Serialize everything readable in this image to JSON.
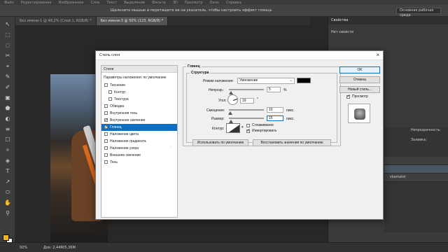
{
  "app": {
    "menu": [
      "Файл",
      "Редактирование",
      "Изображение",
      "Слои",
      "Текст",
      "Выделение",
      "Фильтр",
      "3D",
      "Просмотр",
      "Окно",
      "Справка"
    ],
    "options_hint": "Щелкните мышью и перетащите ее на указатель, чтобы настроить эффект глянца.",
    "workspace": "Основная рабочая среда"
  },
  "tabs": [
    "Без имени-1 @ 48,2% (Слой 1, RGB/8) *",
    "Без имени-3 @ 50% (123, RGB/8) *"
  ],
  "tools": [
    "↖",
    "⬚",
    "◌",
    "✂",
    "⌖",
    "✎",
    "✐",
    "▣",
    "⬟",
    "◐",
    "≡",
    "☐",
    "✧",
    "◈",
    "T",
    "↗",
    "⬭",
    "✋",
    "⚲"
  ],
  "colors": {
    "foreground": "#f2b51d",
    "background": "#ffffff",
    "selection": "#0a6fc2"
  },
  "right_panel": {
    "title": "Свойства",
    "no_properties": "Нет свойств",
    "opacity_label": "Непрозрачность:",
    "fill_label": "Заливка:",
    "layer_name": "vkamahd"
  },
  "status": {
    "zoom": "50%",
    "doc": "Док: 2,44M/5,36M"
  },
  "dialog": {
    "title": "Стиль слоя",
    "styles_header": "Стили",
    "blend_defaults": "Параметры наложения: по умолчанию",
    "styles": [
      {
        "label": "Тиснение",
        "checked": false,
        "indent": false,
        "selected": false
      },
      {
        "label": "Контур",
        "checked": false,
        "indent": true,
        "selected": false
      },
      {
        "label": "Текстура",
        "checked": false,
        "indent": true,
        "selected": false
      },
      {
        "label": "Обводка",
        "checked": false,
        "indent": false,
        "selected": false
      },
      {
        "label": "Внутренняя тень",
        "checked": false,
        "indent": false,
        "selected": false
      },
      {
        "label": "Внутреннее свечение",
        "checked": true,
        "indent": false,
        "selected": false
      },
      {
        "label": "Глянец",
        "checked": true,
        "indent": false,
        "selected": true
      },
      {
        "label": "Наложение цвета",
        "checked": false,
        "indent": false,
        "selected": false
      },
      {
        "label": "Наложение градиента",
        "checked": false,
        "indent": false,
        "selected": false
      },
      {
        "label": "Наложение узора",
        "checked": false,
        "indent": false,
        "selected": false
      },
      {
        "label": "Внешнее свечение",
        "checked": false,
        "indent": false,
        "selected": false
      },
      {
        "label": "Тень",
        "checked": false,
        "indent": false,
        "selected": false
      }
    ],
    "satin": {
      "group_title": "Глянец",
      "structure_title": "Структура",
      "blend_mode_label": "Режим наложения:",
      "blend_mode_value": "Умножение",
      "opacity_label": "Непрозр.:",
      "opacity_value": "5",
      "opacity_unit": "%",
      "opacity_level": 0.05,
      "angle_label": "Угол:",
      "angle_value": "19",
      "angle_unit": "°",
      "distance_label": "Смещение:",
      "distance_value": "10",
      "distance_unit": "пикс.",
      "distance_level": 0.04,
      "size_label": "Размер:",
      "size_value": "15",
      "size_unit": "пикс.",
      "size_level": 0.06,
      "contour_label": "Контур:",
      "antialias_label": "Сглаживание",
      "antialias_checked": false,
      "invert_label": "Инвертировать",
      "invert_checked": true,
      "make_default": "Использовать по умолчанию",
      "reset_default": "Восстановить значения по умолчанию",
      "color": "#000000"
    },
    "buttons": {
      "ok": "OK",
      "cancel": "Отмена",
      "new_style": "Новый стиль...",
      "preview_label": "Просмотр",
      "preview_checked": true
    }
  }
}
